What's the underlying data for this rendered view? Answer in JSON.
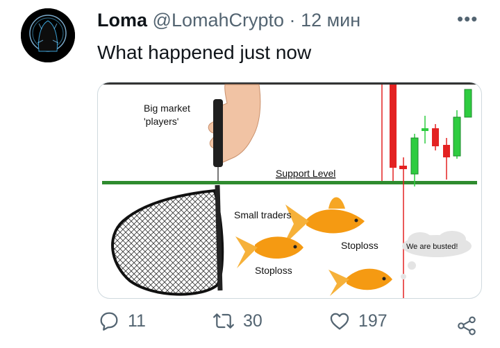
{
  "tweet": {
    "author_name": "Loma",
    "handle": "@LomahCrypto",
    "separator": "·",
    "time": "12 мин",
    "more": "•••",
    "text": "What happened just now"
  },
  "media": {
    "label_big_players": [
      "Big market",
      "'players'"
    ],
    "label_support": "Support Level",
    "label_small_traders": "Small traders",
    "label_stoploss": "Stoploss",
    "label_busted": "We are busted!"
  },
  "actions": {
    "reply_count": "11",
    "retweet_count": "30",
    "like_count": "197"
  },
  "colors": {
    "support_green": "#2e8b2e",
    "candle_green": "#2ecc40",
    "candle_red": "#e32222",
    "fish_orange": "#f59a12",
    "icon_gray": "#536471"
  }
}
